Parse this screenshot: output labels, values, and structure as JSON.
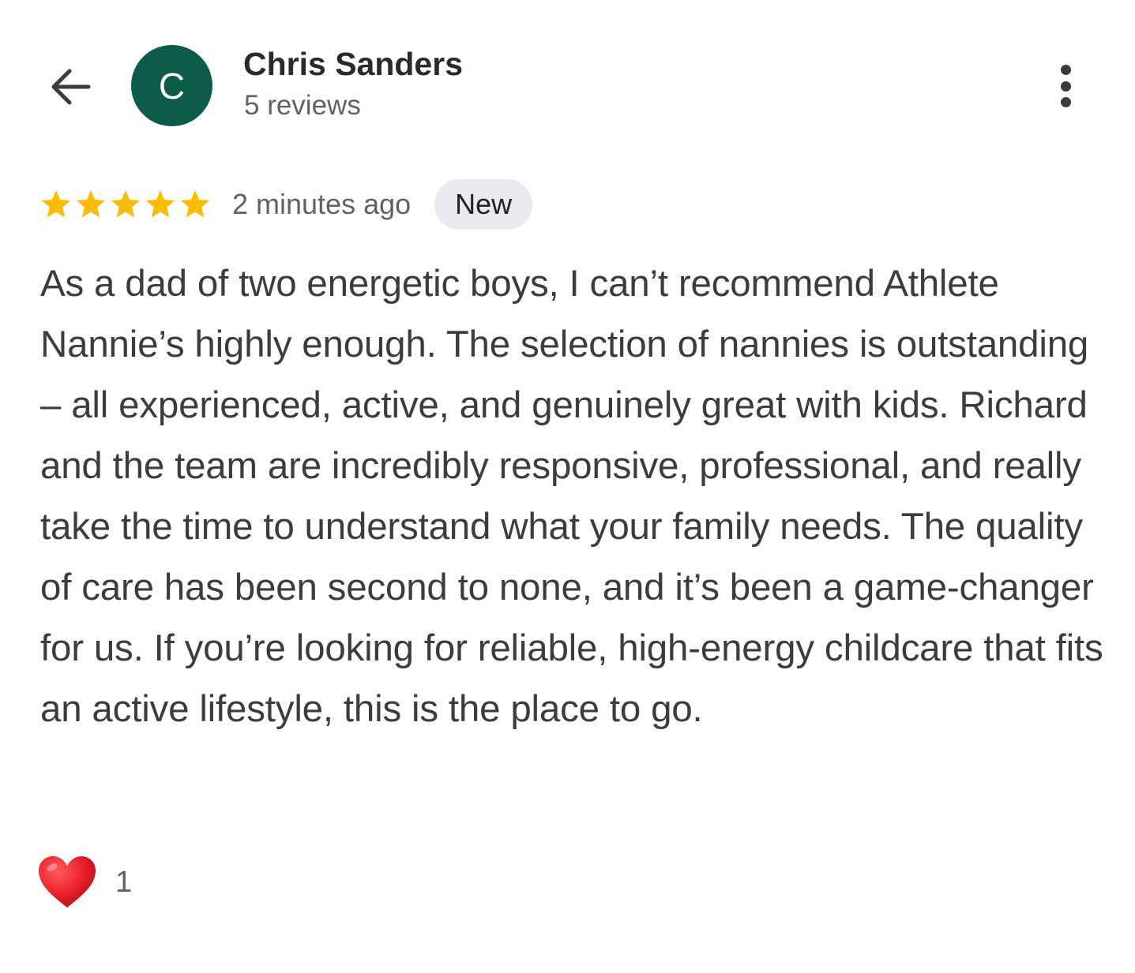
{
  "header": {
    "back_icon": "arrow-left-icon",
    "avatar_letter": "C",
    "avatar_color": "#0d5c49",
    "reviewer_name": "Chris Sanders",
    "review_count": "5 reviews",
    "more_icon": "more-vert-icon"
  },
  "review": {
    "rating": 5,
    "rating_max": 5,
    "star_color": "#fbbc04",
    "timestamp": "2 minutes ago",
    "badge": "New",
    "text": "As a dad of two energetic boys, I can’t recommend Athlete Nannie’s highly enough. The selection of nannies is outstanding – all experienced, active, and genuinely great with kids. Richard and the team are incredibly responsive, professional, and really take the time to understand what your family needs. The quality of care has been second to none, and it’s been a game-changer for us. If you’re looking for reliable, high-energy childcare that fits an active lifestyle, this is the place to go."
  },
  "reaction": {
    "icon": "heart-icon",
    "count": "1"
  }
}
